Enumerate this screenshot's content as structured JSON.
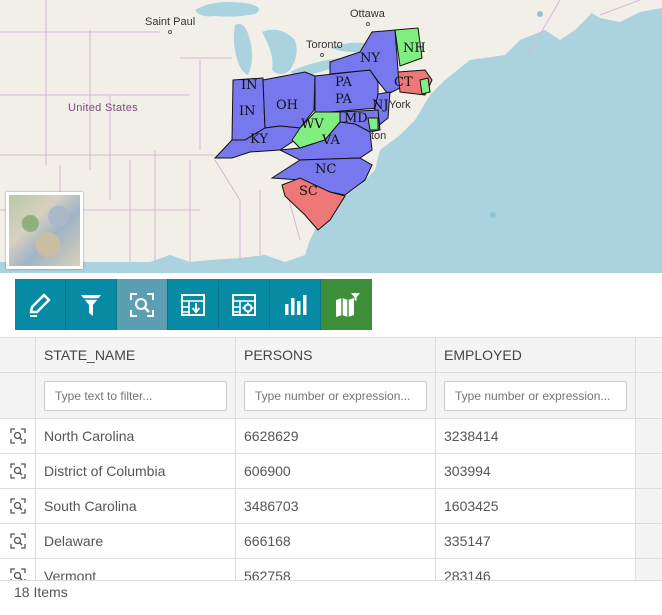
{
  "map": {
    "country_label": "United States",
    "cities": [
      "Saint Paul",
      "Ottawa",
      "Toronto",
      "York",
      "ton"
    ],
    "state_labels": [
      "IN",
      "IN",
      "OH",
      "KY",
      "PA",
      "PA",
      "NY",
      "NH",
      "CT",
      "NJ",
      "MD",
      "WV",
      "VA",
      "NC",
      "SC"
    ],
    "colors": {
      "blue": "#7777ee",
      "green": "#80ee80",
      "red": "#ee7777",
      "water": "#aad3df",
      "land": "#f2efe9"
    }
  },
  "toolbar": {
    "tools": [
      {
        "icon": "pencil-icon"
      },
      {
        "icon": "filter-icon"
      },
      {
        "icon": "zoom-to-selection-icon"
      },
      {
        "icon": "export-table-icon"
      },
      {
        "icon": "table-settings-icon"
      },
      {
        "icon": "bar-chart-icon"
      },
      {
        "icon": "sync-map-filter-icon"
      }
    ]
  },
  "grid": {
    "columns": [
      "STATE_NAME",
      "PERSONS",
      "EMPLOYED"
    ],
    "filters": {
      "state_name": "Type text to filter...",
      "persons": "Type number or expression...",
      "employed": "Type number or expression..."
    },
    "rows": [
      [
        "North Carolina",
        "6628629",
        "3238414"
      ],
      [
        "District of Columbia",
        "606900",
        "303994"
      ],
      [
        "South Carolina",
        "3486703",
        "1603425"
      ],
      [
        "Delaware",
        "666168",
        "335147"
      ],
      [
        "Vermont",
        "562758",
        "283146"
      ]
    ],
    "footer": "18 Items"
  }
}
